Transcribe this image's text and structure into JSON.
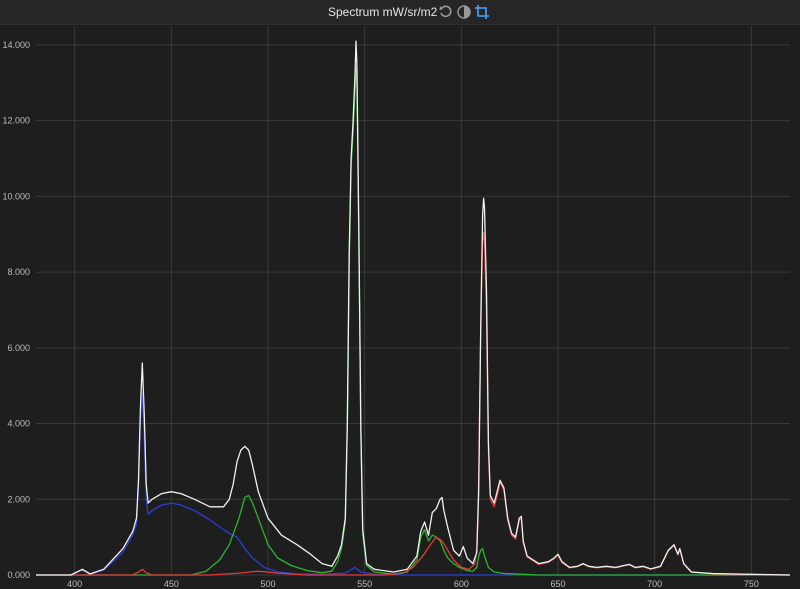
{
  "header": {
    "title": "Spectrum mW/sr/m2",
    "icons": [
      "reset-icon",
      "contrast-icon",
      "crop-icon"
    ]
  },
  "colors": {
    "background": "#1e1e1e",
    "grid": "#3a3a3a",
    "total": "#f0f0f0",
    "red": "#e23b3b",
    "green": "#2db52d",
    "blue": "#2b3fd6",
    "accent": "#4aa3ff"
  },
  "chart_data": {
    "type": "line",
    "title": "Spectrum mW/sr/m2",
    "xlabel": "",
    "ylabel": "",
    "xlim": [
      380,
      770
    ],
    "ylim": [
      0,
      14500
    ],
    "grid": true,
    "x_ticks": [
      "400",
      "450",
      "500",
      "550",
      "600",
      "650",
      "700",
      "750"
    ],
    "y_ticks": [
      "0.000",
      "2.000",
      "4.000",
      "6.000",
      "8.000",
      "10.000",
      "12.000",
      "14.000"
    ],
    "series": [
      {
        "color": "#f0f0f0",
        "points": [
          [
            380,
            0
          ],
          [
            398,
            0
          ],
          [
            404,
            150
          ],
          [
            408,
            30
          ],
          [
            415,
            150
          ],
          [
            425,
            700
          ],
          [
            430,
            1150
          ],
          [
            432,
            1500
          ],
          [
            433,
            2500
          ],
          [
            434,
            4400
          ],
          [
            435,
            5600
          ],
          [
            436,
            4200
          ],
          [
            437,
            2400
          ],
          [
            438,
            1900
          ],
          [
            440,
            2000
          ],
          [
            445,
            2150
          ],
          [
            450,
            2200
          ],
          [
            455,
            2150
          ],
          [
            462,
            2000
          ],
          [
            470,
            1800
          ],
          [
            477,
            1800
          ],
          [
            480,
            2000
          ],
          [
            482,
            2400
          ],
          [
            484,
            3000
          ],
          [
            486,
            3300
          ],
          [
            488,
            3400
          ],
          [
            490,
            3300
          ],
          [
            492,
            2900
          ],
          [
            495,
            2200
          ],
          [
            500,
            1500
          ],
          [
            507,
            1050
          ],
          [
            515,
            800
          ],
          [
            522,
            550
          ],
          [
            528,
            300
          ],
          [
            533,
            230
          ],
          [
            536,
            500
          ],
          [
            538,
            800
          ],
          [
            540,
            1500
          ],
          [
            541,
            4000
          ],
          [
            542,
            8500
          ],
          [
            543,
            11000
          ],
          [
            544,
            12000
          ],
          [
            545,
            13200
          ],
          [
            545.5,
            14100
          ],
          [
            546,
            13500
          ],
          [
            547,
            9000
          ],
          [
            548,
            4000
          ],
          [
            549,
            1200
          ],
          [
            551,
            300
          ],
          [
            555,
            150
          ],
          [
            565,
            80
          ],
          [
            572,
            150
          ],
          [
            577,
            500
          ],
          [
            579,
            1150
          ],
          [
            581,
            1400
          ],
          [
            583,
            1050
          ],
          [
            585,
            1650
          ],
          [
            587,
            1750
          ],
          [
            589,
            2000
          ],
          [
            590,
            2050
          ],
          [
            591,
            1700
          ],
          [
            593,
            1250
          ],
          [
            596,
            650
          ],
          [
            599,
            500
          ],
          [
            601,
            750
          ],
          [
            603,
            450
          ],
          [
            606,
            300
          ],
          [
            608,
            600
          ],
          [
            609,
            2200
          ],
          [
            610,
            6500
          ],
          [
            611,
            9500
          ],
          [
            611.5,
            9950
          ],
          [
            612,
            9700
          ],
          [
            613,
            7500
          ],
          [
            614,
            3500
          ],
          [
            615,
            2100
          ],
          [
            617,
            1900
          ],
          [
            619,
            2300
          ],
          [
            620,
            2500
          ],
          [
            622,
            2300
          ],
          [
            624,
            1500
          ],
          [
            626,
            1100
          ],
          [
            628,
            1000
          ],
          [
            630,
            1500
          ],
          [
            631,
            1550
          ],
          [
            632,
            900
          ],
          [
            634,
            500
          ],
          [
            640,
            300
          ],
          [
            645,
            350
          ],
          [
            648,
            450
          ],
          [
            650,
            550
          ],
          [
            652,
            350
          ],
          [
            656,
            200
          ],
          [
            660,
            230
          ],
          [
            663,
            300
          ],
          [
            666,
            230
          ],
          [
            670,
            200
          ],
          [
            675,
            230
          ],
          [
            680,
            200
          ],
          [
            684,
            250
          ],
          [
            687,
            280
          ],
          [
            690,
            200
          ],
          [
            694,
            230
          ],
          [
            698,
            160
          ],
          [
            703,
            230
          ],
          [
            707,
            650
          ],
          [
            710,
            800
          ],
          [
            712,
            550
          ],
          [
            713,
            700
          ],
          [
            715,
            300
          ],
          [
            719,
            80
          ],
          [
            730,
            40
          ],
          [
            745,
            20
          ],
          [
            760,
            10
          ],
          [
            770,
            0
          ]
        ]
      },
      {
        "color": "#e23b3b",
        "points": [
          [
            380,
            0
          ],
          [
            430,
            0
          ],
          [
            433,
            80
          ],
          [
            435,
            150
          ],
          [
            437,
            60
          ],
          [
            440,
            0
          ],
          [
            470,
            0
          ],
          [
            485,
            50
          ],
          [
            495,
            100
          ],
          [
            505,
            50
          ],
          [
            520,
            0
          ],
          [
            560,
            0
          ],
          [
            570,
            50
          ],
          [
            575,
            200
          ],
          [
            580,
            500
          ],
          [
            584,
            800
          ],
          [
            587,
            1000
          ],
          [
            590,
            900
          ],
          [
            593,
            650
          ],
          [
            596,
            400
          ],
          [
            600,
            200
          ],
          [
            604,
            150
          ],
          [
            607,
            300
          ],
          [
            608,
            700
          ],
          [
            609,
            2500
          ],
          [
            610,
            6500
          ],
          [
            611,
            8800
          ],
          [
            611.5,
            9050
          ],
          [
            612,
            8800
          ],
          [
            613,
            7000
          ],
          [
            614,
            3300
          ],
          [
            615,
            2000
          ],
          [
            617,
            1800
          ],
          [
            619,
            2200
          ],
          [
            620,
            2450
          ],
          [
            622,
            2250
          ],
          [
            624,
            1450
          ],
          [
            626,
            1050
          ],
          [
            628,
            950
          ],
          [
            630,
            1450
          ],
          [
            631,
            1500
          ],
          [
            632,
            850
          ],
          [
            634,
            480
          ],
          [
            640,
            280
          ],
          [
            645,
            330
          ],
          [
            648,
            430
          ],
          [
            650,
            530
          ],
          [
            652,
            330
          ],
          [
            656,
            190
          ],
          [
            660,
            220
          ],
          [
            663,
            290
          ],
          [
            666,
            220
          ],
          [
            670,
            190
          ],
          [
            675,
            220
          ],
          [
            680,
            190
          ],
          [
            684,
            240
          ],
          [
            687,
            270
          ],
          [
            690,
            190
          ],
          [
            694,
            220
          ],
          [
            698,
            150
          ],
          [
            703,
            220
          ],
          [
            707,
            630
          ],
          [
            710,
            780
          ],
          [
            712,
            530
          ],
          [
            713,
            680
          ],
          [
            715,
            290
          ],
          [
            719,
            70
          ],
          [
            730,
            30
          ],
          [
            745,
            15
          ],
          [
            760,
            5
          ],
          [
            770,
            0
          ]
        ]
      },
      {
        "color": "#2db52d",
        "points": [
          [
            380,
            0
          ],
          [
            460,
            0
          ],
          [
            468,
            100
          ],
          [
            475,
            400
          ],
          [
            480,
            800
          ],
          [
            485,
            1500
          ],
          [
            488,
            2050
          ],
          [
            490,
            2100
          ],
          [
            492,
            1900
          ],
          [
            495,
            1500
          ],
          [
            500,
            800
          ],
          [
            505,
            450
          ],
          [
            512,
            250
          ],
          [
            520,
            120
          ],
          [
            528,
            60
          ],
          [
            533,
            100
          ],
          [
            536,
            350
          ],
          [
            538,
            700
          ],
          [
            540,
            1400
          ],
          [
            541,
            3800
          ],
          [
            542,
            8200
          ],
          [
            543,
            10800
          ],
          [
            544,
            11700
          ],
          [
            545,
            12800
          ],
          [
            545.5,
            13400
          ],
          [
            546,
            13000
          ],
          [
            547,
            8600
          ],
          [
            548,
            3800
          ],
          [
            549,
            1100
          ],
          [
            551,
            250
          ],
          [
            555,
            80
          ],
          [
            565,
            20
          ],
          [
            572,
            80
          ],
          [
            577,
            400
          ],
          [
            579,
            1000
          ],
          [
            581,
            1200
          ],
          [
            583,
            900
          ],
          [
            585,
            1050
          ],
          [
            587,
            1000
          ],
          [
            589,
            900
          ],
          [
            591,
            650
          ],
          [
            593,
            450
          ],
          [
            596,
            300
          ],
          [
            599,
            200
          ],
          [
            603,
            120
          ],
          [
            606,
            100
          ],
          [
            608,
            200
          ],
          [
            609,
            500
          ],
          [
            610,
            650
          ],
          [
            611,
            700
          ],
          [
            612,
            500
          ],
          [
            614,
            200
          ],
          [
            617,
            80
          ],
          [
            622,
            40
          ],
          [
            630,
            20
          ],
          [
            640,
            0
          ],
          [
            770,
            0
          ]
        ]
      },
      {
        "color": "#2b3fd6",
        "points": [
          [
            380,
            0
          ],
          [
            398,
            0
          ],
          [
            404,
            130
          ],
          [
            408,
            20
          ],
          [
            415,
            130
          ],
          [
            425,
            600
          ],
          [
            430,
            1050
          ],
          [
            432,
            1350
          ],
          [
            433,
            2300
          ],
          [
            434,
            4100
          ],
          [
            435,
            4800
          ],
          [
            436,
            3600
          ],
          [
            437,
            2000
          ],
          [
            438,
            1600
          ],
          [
            440,
            1700
          ],
          [
            445,
            1850
          ],
          [
            450,
            1900
          ],
          [
            455,
            1850
          ],
          [
            462,
            1700
          ],
          [
            470,
            1450
          ],
          [
            477,
            1200
          ],
          [
            480,
            1100
          ],
          [
            484,
            1000
          ],
          [
            488,
            700
          ],
          [
            492,
            450
          ],
          [
            498,
            200
          ],
          [
            505,
            80
          ],
          [
            515,
            30
          ],
          [
            530,
            20
          ],
          [
            540,
            50
          ],
          [
            545,
            200
          ],
          [
            548,
            80
          ],
          [
            555,
            20
          ],
          [
            570,
            0
          ],
          [
            770,
            0
          ]
        ]
      }
    ]
  }
}
